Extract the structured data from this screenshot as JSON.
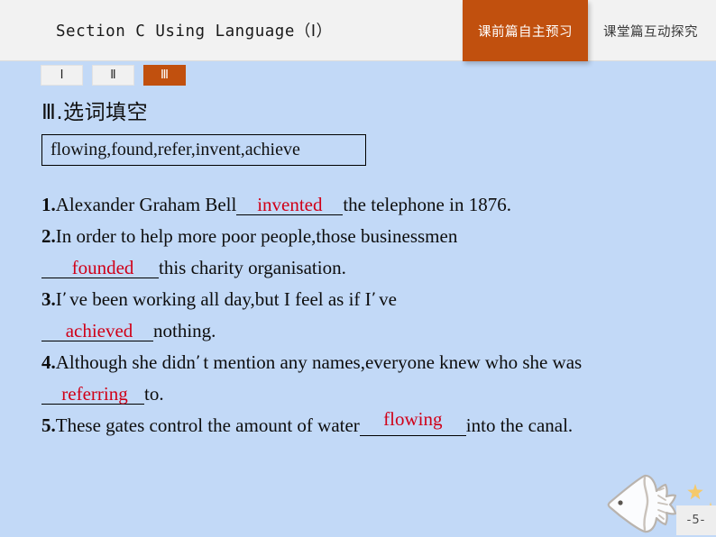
{
  "header": {
    "title": "Section C  Using Language（Ⅰ）",
    "tabs": [
      {
        "label": "课前篇自主预习",
        "active": true
      },
      {
        "label": "课堂篇互动探究",
        "active": false
      }
    ]
  },
  "subtabs": [
    {
      "label": "Ⅰ",
      "active": false
    },
    {
      "label": "Ⅱ",
      "active": false
    },
    {
      "label": "Ⅲ",
      "active": true
    }
  ],
  "section": {
    "heading": "Ⅲ.选词填空",
    "word_bank": "flowing,found,refer,invent,achieve"
  },
  "questions": [
    {
      "number": "1.",
      "pre": "Alexander Graham Bell",
      "answer": "invented",
      "post": "the telephone in 1876."
    },
    {
      "number": "2.",
      "pre": "In order to help more poor people,those businessmen",
      "answer": "founded",
      "post": "this charity organisation."
    },
    {
      "number": "3.",
      "pre_a": "I",
      "apostrophe": "’",
      "pre_b": "ve been working all day,but I feel as if I",
      "apostrophe2": "’",
      "pre_c": "ve",
      "answer": "achieved",
      "post": "nothing."
    },
    {
      "number": "4.",
      "pre_a": "Although she didn",
      "apostrophe": "’",
      "pre_b": "t mention any names,everyone knew who she was",
      "answer": "referring",
      "post": "to."
    },
    {
      "number": "5.",
      "pre": "These gates control the amount of water",
      "answer": "flowing",
      "post": "into the canal."
    }
  ],
  "decorations": {
    "page_number": "-5-",
    "fish_icon": "fish-icon",
    "star_icon": "star-icon"
  },
  "colors": {
    "accent_orange": "#c1500e",
    "background_blue": "#c2d9f7",
    "header_gray": "#f2f2f2",
    "answer_red": "#d00018"
  }
}
